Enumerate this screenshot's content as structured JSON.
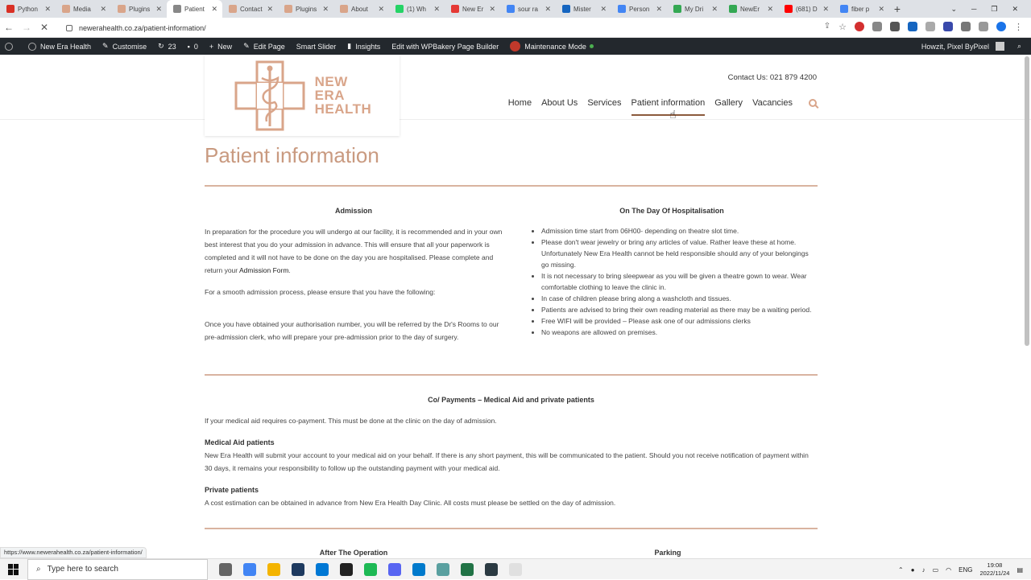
{
  "browser": {
    "tabs": [
      {
        "label": "Python",
        "color": "#d93025"
      },
      {
        "label": "Media",
        "color": "#d9a58a"
      },
      {
        "label": "Plugins",
        "color": "#d9a58a"
      },
      {
        "label": "Patient",
        "color": "#888888"
      },
      {
        "label": "Contact",
        "color": "#d9a58a"
      },
      {
        "label": "Plugins",
        "color": "#d9a58a"
      },
      {
        "label": "About",
        "color": "#d9a58a"
      },
      {
        "label": "(1) Wh",
        "color": "#25d366"
      },
      {
        "label": "New Er",
        "color": "#e53935"
      },
      {
        "label": "sour ra",
        "color": "#4285f4"
      },
      {
        "label": "Mister",
        "color": "#1565c0"
      },
      {
        "label": "Person",
        "color": "#4285f4"
      },
      {
        "label": "My Dri",
        "color": "#34a853"
      },
      {
        "label": "NewEr",
        "color": "#34a853"
      },
      {
        "label": "(681) D",
        "color": "#ff0000"
      },
      {
        "label": "fiber p",
        "color": "#4285f4"
      }
    ],
    "active_tab_index": 3,
    "new_tab_label": "+",
    "url": "newerahealth.co.za/patient-information/",
    "status_url": "https://www.newerahealth.co.za/patient-information/"
  },
  "adminbar": {
    "items": [
      "New Era Health",
      "Customise",
      "23",
      "0",
      "New",
      "Edit Page",
      "Smart Slider",
      "Insights",
      "Edit with WPBakery Page Builder",
      "Maintenance Mode"
    ],
    "greeting": "Howzit, Pixel ByPixel"
  },
  "site": {
    "logo_lines": [
      "NEW",
      "ERA",
      "HEALTH"
    ],
    "contact": "Contact Us: 021 879 4200",
    "nav": [
      "Home",
      "About Us",
      "Services",
      "Patient information",
      "Gallery",
      "Vacancies"
    ],
    "active_nav_index": 3,
    "accent": "#d9a58a",
    "title_color": "#c99a80"
  },
  "content": {
    "page_title": "Patient information",
    "admission": {
      "title": "Admission",
      "p1_before": "In preparation for the procedure you will undergo at our facility, it is recommended and in your own best interest that you do your admission in advance. This will ensure that all your paperwork is completed and it will not have to be done on the day you are hospitalised. Please complete and return your ",
      "p1_link": "Admission Form",
      "p1_after": ".",
      "p2": "For a smooth admission process, please ensure that you have the following:",
      "p3": "Once you have obtained your authorisation  number, you will be referred by the Dr's Rooms to our pre-admission clerk, who will prepare your pre-admission prior to the day of surgery."
    },
    "hospitalisation": {
      "title": "On The Day Of Hospitalisation",
      "items": [
        "Admission time start from 06H00- depending on theatre slot time.",
        "Please don't wear jewelry or bring any articles of value. Rather leave these at home. Unfortunately New Era Health cannot be held responsible should any of your belongings go missing.",
        "It is not necessary to bring sleepwear as you will be given a theatre gown to wear. Wear comfortable clothing to leave the clinic in.",
        "In case of children please bring along a washcloth and tissues.",
        "Patients are advised to bring their own reading material as there may be a waiting period.",
        "Free WIFI will be provided – Please ask one of our admissions clerks",
        "No weapons are allowed on premises."
      ]
    },
    "payments": {
      "title": "Co/ Payments – Medical Aid and private patients",
      "p1": "If  your medical aid requires co-payment. This must be done at the clinic on the day of admission.",
      "medical_title": "Medical Aid patients",
      "medical_text": "New Era Health will submit your account to your medical aid on your behalf. If there is any short payment, this will be communicated to the patient. Should you not receive notification of payment within 30 days, it remains your responsibility to follow up the outstanding payment with your medical aid.",
      "private_title": "Private patients",
      "private_text": "A cost estimation can be obtained in advance from New Era Health Day Clinic. All costs must please be settled on the day of admission."
    },
    "after_title": "After The Operation",
    "parking_title": "Parking"
  },
  "taskbar": {
    "search_placeholder": "Type here to search",
    "app_colors": [
      "#666666",
      "#4285f4",
      "#f4b400",
      "#1e3a5f",
      "#0078d4",
      "#222222",
      "#1db954",
      "#5865f2",
      "#007acc",
      "#5aa0a0",
      "#217346",
      "#2b3a42",
      "#e0e0e0"
    ],
    "lang": "ENG",
    "time": "19:08",
    "date": "2022/11/24"
  }
}
